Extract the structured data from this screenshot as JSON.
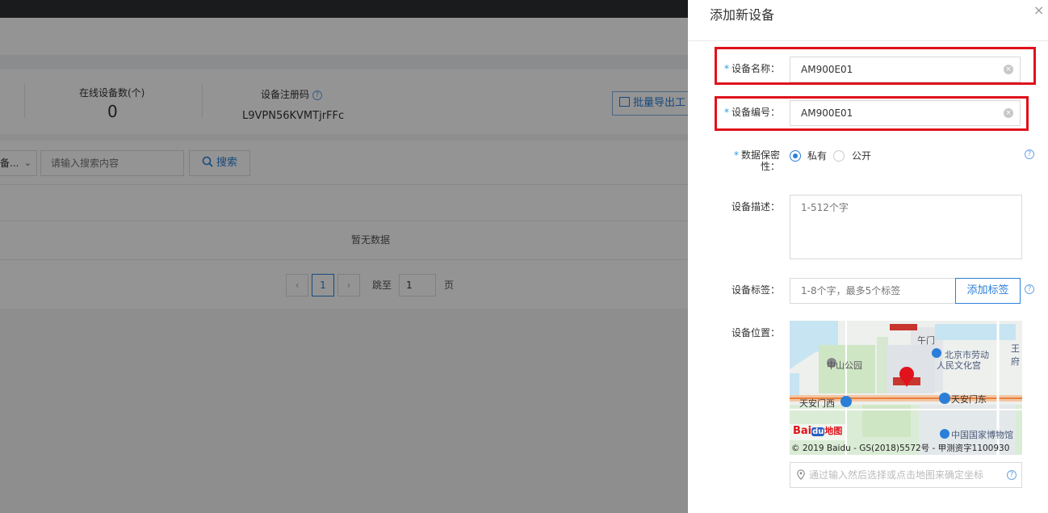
{
  "background": {
    "stats": {
      "online_label": "在线设备数(个)",
      "online_value": "0",
      "regcode_label": "设备注册码",
      "regcode_value": "L9VPN56KVMTjrFFc",
      "help": "?"
    },
    "export_label": "批量导出工",
    "search": {
      "select_value": "备...",
      "select_chevron": "⌄",
      "input_placeholder": "请输入搜索内容",
      "button_label": "搜索"
    },
    "table": {
      "empty_text": "暂无数据"
    },
    "pagination": {
      "prev": "‹",
      "current_page": "1",
      "next": "›",
      "jump_label": "跳至",
      "jump_value": "1",
      "page_suffix": "页"
    }
  },
  "drawer": {
    "title": "添加新设备",
    "close": "×",
    "fields": {
      "name": {
        "required": "*",
        "label": "设备名称：",
        "value": "AM900E01"
      },
      "code": {
        "required": "*",
        "label": "设备编号：",
        "value": "AM900E01"
      },
      "privacy": {
        "required": "*",
        "label_line1": "数据保密",
        "label_line2": "性：",
        "options": [
          "私有",
          "公开"
        ],
        "selected": "私有"
      },
      "description": {
        "label": "设备描述：",
        "placeholder": "1-512个字"
      },
      "tags": {
        "label": "设备标签：",
        "placeholder": "1-8个字，最多5个标签",
        "button_label": "添加标签"
      },
      "location": {
        "label": "设备位置：",
        "placeholder": "通过输入然后选择或点击地图来确定坐标",
        "map_labels": {
          "wumen": "午门",
          "zhongshan_park": "中山公园",
          "labor_palace_1": "北京市劳动",
          "labor_palace_2": "人民文化宫",
          "tiananmen_west": "天安门西",
          "tiananmen_east": "天安门东",
          "museum": "中国国家博物馆",
          "wangfu": "王府",
          "copyright": "© 2019 Baidu - GS(2018)5572号 - 甲测资字1100930",
          "logo_text": "Bai",
          "logo_du": "du",
          "logo_map": "地图"
        }
      }
    },
    "help": "?"
  },
  "colors": {
    "accent": "#2b7fd9",
    "highlight": "#e0121c",
    "required": "#2b9be0",
    "overlay": "rgba(0,0,0,0.42)"
  }
}
